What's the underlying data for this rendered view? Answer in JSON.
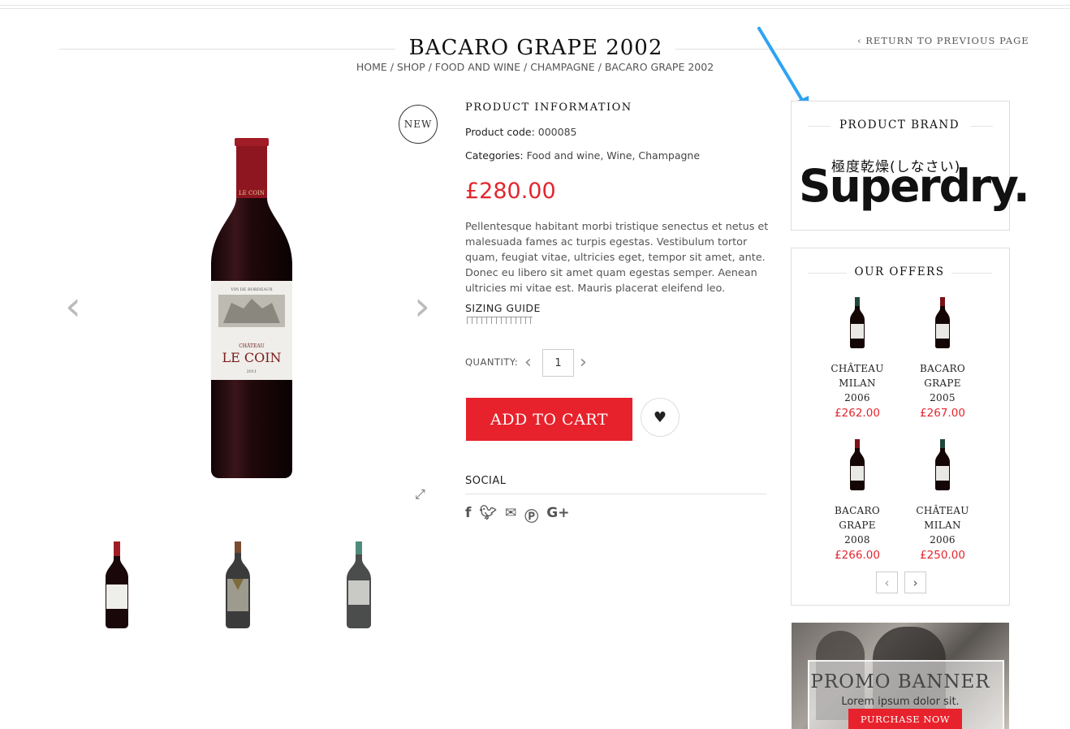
{
  "page": {
    "title": "BACARO GRAPE 2002",
    "return_link": "‹ RETURN TO PREVIOUS PAGE",
    "breadcrumb": "HOME / SHOP / FOOD AND WINE / CHAMPAGNE / BACARO GRAPE 2002"
  },
  "gallery": {
    "badge": "NEW",
    "main_label_small": "VIN DE BORDEAUX",
    "main_label_top": "CHÂTEAU",
    "main_label_name": "LE COIN",
    "main_label_year": "2011"
  },
  "product": {
    "info_heading": "PRODUCT INFORMATION",
    "code_label": "Product code:",
    "code_value": "000085",
    "categories_label": "Categories:",
    "category_1": "Food and wine",
    "category_2": "Wine",
    "category_3": "Champagne",
    "price": "£280.00",
    "description": "Pellentesque habitant morbi tristique senectus et netus et malesuada fames ac turpis egestas. Vestibulum tortor quam, feugiat vitae, ultricies eget, tempor sit amet, ante. Donec eu libero sit amet quam egestas semper. Aenean ultricies mi vitae est. Mauris placerat eleifend leo.",
    "sizing_guide": "SIZING GUIDE",
    "quantity_label": "QUANTITY:",
    "quantity_value": "1",
    "add_to_cart": "ADD TO CART",
    "social_heading": "SOCIAL"
  },
  "sidebar": {
    "brand_heading": "PRODUCT BRAND",
    "brand_jp": "極度乾燥(しなさい)",
    "brand_name": "Superdry.",
    "offers_heading": "OUR OFFERS",
    "offers": [
      {
        "name_1": "CHÂTEAU",
        "name_2": "MILAN",
        "year": "2006",
        "price": "£262.00",
        "color": "#1f4a3a"
      },
      {
        "name_1": "BACARO",
        "name_2": "GRAPE",
        "year": "2005",
        "price": "£267.00",
        "color": "#7a1218"
      },
      {
        "name_1": "BACARO",
        "name_2": "GRAPE",
        "year": "2008",
        "price": "£266.00",
        "color": "#7a1218"
      },
      {
        "name_1": "CHÂTEAU",
        "name_2": "MILAN",
        "year": "2006",
        "price": "£250.00",
        "color": "#1f4a3a"
      }
    ],
    "promo_title": "PROMO BANNER",
    "promo_sub": "Lorem ipsum dolor sit.",
    "promo_button": "PURCHASE NOW"
  },
  "colors": {
    "accent": "#e8222c",
    "annotation_arrow": "#2ea3f2"
  }
}
